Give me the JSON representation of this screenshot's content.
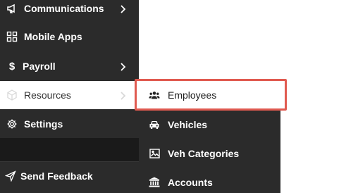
{
  "sidebar": {
    "items": [
      {
        "label": "Communications",
        "icon": "megaphone-icon"
      },
      {
        "label": "Mobile Apps",
        "icon": "grid-icon"
      },
      {
        "label": "Payroll",
        "icon": "dollar-icon"
      },
      {
        "label": "Resources",
        "icon": "cube-icon"
      },
      {
        "label": "Settings",
        "icon": "gear-icon"
      }
    ],
    "feedback_label": "Send Feedback"
  },
  "submenu": {
    "items": [
      {
        "label": "Employees",
        "icon": "users-icon"
      },
      {
        "label": "Vehicles",
        "icon": "car-icon"
      },
      {
        "label": "Veh Categories",
        "icon": "picture-icon"
      },
      {
        "label": "Accounts",
        "icon": "bank-icon"
      }
    ]
  },
  "colors": {
    "sidebar_bg": "#2b2b2b",
    "highlight_border": "#e05a50",
    "active_bg": "#ffffff"
  }
}
